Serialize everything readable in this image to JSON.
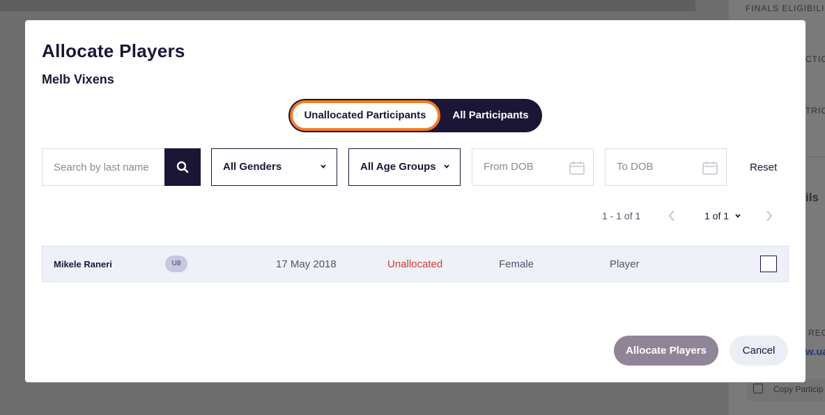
{
  "background": {
    "side_texts": [
      "FINALS ELIGIBILI",
      "CTIO",
      "TRIC",
      "ils",
      "REC"
    ],
    "side_link": "w.ua",
    "copy_label": "Copy Particip"
  },
  "modal": {
    "title": "Allocate Players",
    "subtitle": "Melb Vixens",
    "toggle": {
      "active_label": "Unallocated Participants",
      "inactive_label": "All Participants"
    },
    "filters": {
      "search_placeholder": "Search by last name",
      "gender_label": "All Genders",
      "age_group_label": "All Age Groups",
      "from_dob_placeholder": "From DOB",
      "to_dob_placeholder": "To DOB",
      "reset_label": "Reset"
    },
    "pagination": {
      "range": "1 - 1 of 1",
      "page_label": "1 of 1"
    },
    "rows": [
      {
        "name": "Mikele Raneri",
        "age_group": "U8",
        "dob": "17 May 2018",
        "status": "Unallocated",
        "gender": "Female",
        "role": "Player",
        "checked": false
      }
    ],
    "actions": {
      "allocate_label": "Allocate Players",
      "cancel_label": "Cancel"
    }
  },
  "colors": {
    "brand_dark": "#1c1536",
    "highlight_orange": "#f47b20",
    "status_red": "#d33a3a",
    "disabled_button": "#8f8597"
  }
}
